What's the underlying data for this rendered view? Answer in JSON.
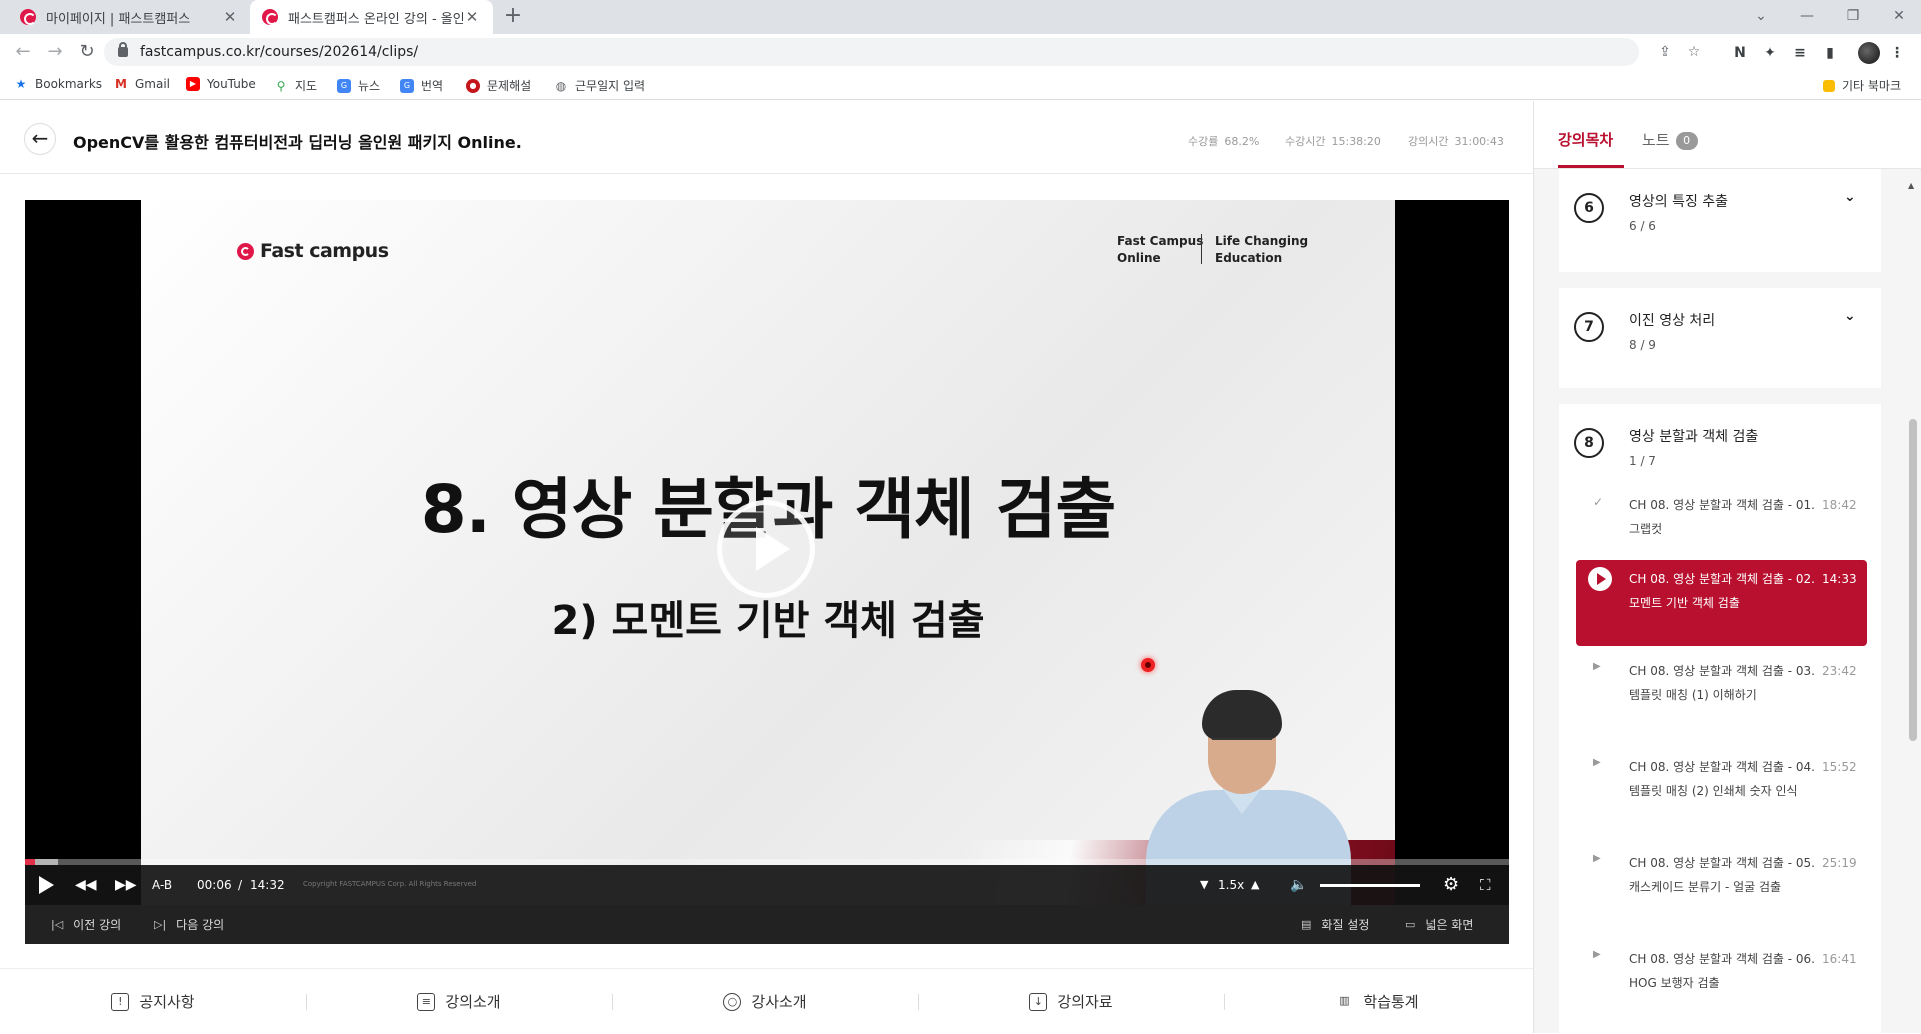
{
  "browser": {
    "tabs": [
      {
        "title": "마이페이지 | 패스트캠퍼스",
        "close": "✕"
      },
      {
        "title": "패스트캠퍼스 온라인 강의 - 올인",
        "close": "✕"
      }
    ],
    "url": "fastcampus.co.kr/courses/202614/clips/",
    "bookmarks": [
      {
        "label": "Bookmarks",
        "icon": "star-icon"
      },
      {
        "label": "Gmail",
        "icon": "gmail-icon"
      },
      {
        "label": "YouTube",
        "icon": "youtube-icon"
      },
      {
        "label": "지도",
        "icon": "maps-icon"
      },
      {
        "label": "뉴스",
        "icon": "news-icon"
      },
      {
        "label": "번역",
        "icon": "translate-icon"
      },
      {
        "label": "문제해설",
        "icon": "bookmark-icon"
      },
      {
        "label": "근무일지 입력",
        "icon": "globe-icon"
      }
    ],
    "other_bookmarks": "기타 북마크"
  },
  "header": {
    "title": "OpenCV를 활용한 컴퓨터비전과 딥러닝 올인원 패키지 Online.",
    "progress_label": "수강률",
    "progress_value": "68.2%",
    "watch_time_label": "수강시간",
    "watch_time_value": "15:38:20",
    "course_time_label": "강의시간",
    "course_time_value": "31:00:43"
  },
  "slide": {
    "logo": "Fast campus",
    "tag_left": "Fast Campus\nOnline",
    "tag_right": "Life Changing\nEducation",
    "title": "8. 영상 분할과 객체 검출",
    "subtitle": "2) 모멘트 기반 객체 검출"
  },
  "player": {
    "ab_label": "A-B",
    "current_time": "00:06",
    "time_sep": "/",
    "duration": "14:32",
    "played_fraction": 0.007,
    "buffered_fraction": 0.022,
    "speed": "1.5x",
    "volume_fraction": 1.0,
    "copyright": "Copyright FASTCAMPUS Corp. All Rights Reserved",
    "prev_lecture": "이전 강의",
    "next_lecture": "다음 강의",
    "quality": "화질 설정",
    "wide_screen": "넓은 화면"
  },
  "bottom_tabs": [
    {
      "label": "공지사항",
      "icon": "notice-icon",
      "glyph": "!"
    },
    {
      "label": "강의소개",
      "icon": "clipboard-icon",
      "glyph": "≡"
    },
    {
      "label": "강사소개",
      "icon": "instructor-icon",
      "glyph": "○"
    },
    {
      "label": "강의자료",
      "icon": "materials-icon",
      "glyph": "↓"
    },
    {
      "label": "학습통계",
      "icon": "stats-icon",
      "glyph": "▥"
    }
  ],
  "side": {
    "tab_curriculum": "강의목차",
    "tab_notes": "노트",
    "notes_count": "0",
    "chapters": [
      {
        "num": "6",
        "title": "영상의 특징 추출",
        "count": "6 / 6"
      },
      {
        "num": "7",
        "title": "이진 영상 처리",
        "count": "8 / 9"
      },
      {
        "num": "8",
        "title": "영상 분할과 객체 검출",
        "count": "1 / 7"
      }
    ],
    "lessons": [
      {
        "title": "CH 08. 영상 분할과 객체 검출 - 01. 그랩컷",
        "time": "18:42",
        "state": "done"
      },
      {
        "title": "CH 08. 영상 분할과 객체 검출 - 02. 모멘트 기반 객체 검출",
        "time": "14:33",
        "state": "playing"
      },
      {
        "title": "CH 08. 영상 분할과 객체 검출 - 03. 템플릿 매칭 (1) 이해하기",
        "time": "23:42",
        "state": "todo"
      },
      {
        "title": "CH 08. 영상 분할과 객체 검출 - 04. 템플릿 매칭 (2) 인쇄체 숫자 인식",
        "time": "15:52",
        "state": "todo"
      },
      {
        "title": "CH 08. 영상 분할과 객체 검출 - 05. 캐스케이드 분류기 - 얼굴 검출",
        "time": "25:19",
        "state": "todo"
      },
      {
        "title": "CH 08. 영상 분할과 객체 검출 - 06. HOG 보행자 검출",
        "time": "16:41",
        "state": "todo"
      }
    ]
  }
}
